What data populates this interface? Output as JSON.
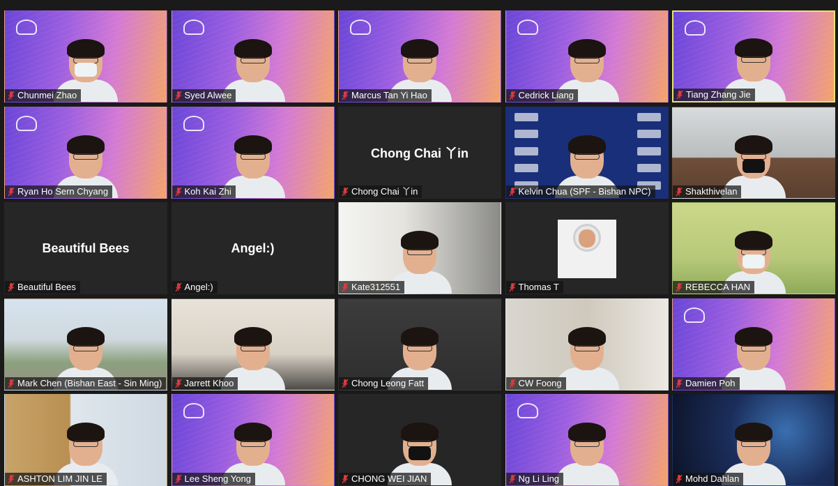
{
  "participants": [
    {
      "name": "Chunmei Zhao",
      "bg": "purple",
      "mask": "white"
    },
    {
      "name": "Syed Alwee",
      "bg": "purple"
    },
    {
      "name": "Marcus Tan Yi Hao",
      "bg": "purple"
    },
    {
      "name": "Cedrick Liang",
      "bg": "purple"
    },
    {
      "name": "Tiang Zhang Jie",
      "bg": "purple",
      "active": true
    },
    {
      "name": "Ryan Ho Sern Chyang",
      "bg": "purple"
    },
    {
      "name": "Koh Kai Zhi",
      "bg": "purple"
    },
    {
      "name": "Chong Chai 丫in",
      "bg": "dark",
      "video_off": true,
      "display_name": "Chong  Chai 丫in"
    },
    {
      "name": "Kelvin Chua (SPF - Bishan NPC)",
      "bg": "police"
    },
    {
      "name": "Shakthivelan",
      "bg": "room",
      "mask": "black"
    },
    {
      "name": "Beautiful Bees",
      "bg": "dark",
      "video_off": true,
      "display_name": "Beautiful Bees"
    },
    {
      "name": "Angel:)",
      "bg": "dark",
      "video_off": true,
      "display_name": "Angel:)"
    },
    {
      "name": "Kate312551",
      "bg": "window"
    },
    {
      "name": "Thomas T",
      "bg": "dark",
      "astronaut": true
    },
    {
      "name": "REBECCA HAN",
      "bg": "bridge",
      "mask": "white"
    },
    {
      "name": "Mark Chen (Bishan East - Sin Ming)",
      "bg": "campus"
    },
    {
      "name": "Jarrett Khoo",
      "bg": "wall"
    },
    {
      "name": "Chong Leong Fatt",
      "bg": "sofa"
    },
    {
      "name": "CW Foong",
      "bg": "home"
    },
    {
      "name": "Damien Poh",
      "bg": "purple"
    },
    {
      "name": "ASHTON LIM JIN LE",
      "bg": "door"
    },
    {
      "name": "Lee Sheng Yong",
      "bg": "purple"
    },
    {
      "name": "CHONG WEI JIAN",
      "bg": "dark",
      "mask": "black"
    },
    {
      "name": "Ng Li Ling",
      "bg": "purple"
    },
    {
      "name": "Mohd Dahlan",
      "bg": "space"
    }
  ],
  "icons": {
    "muted": "mic-muted-icon"
  },
  "colors": {
    "muted_icon": "#e0393e",
    "active_border": "#e8e27a"
  }
}
